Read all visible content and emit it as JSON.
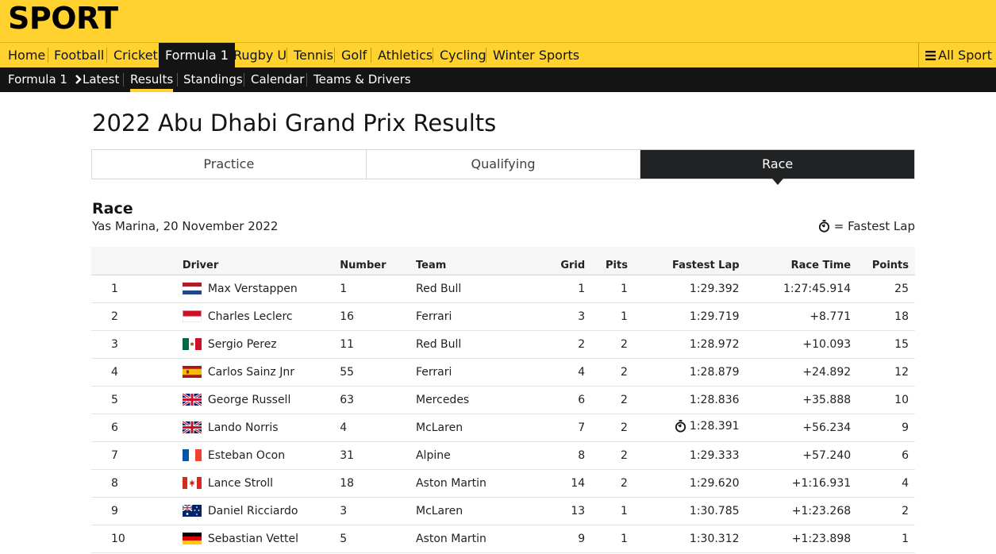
{
  "brand": {
    "logo": "SPORT",
    "accent": "#ffd230",
    "dark": "#202224"
  },
  "primary_nav": {
    "items": [
      "Home",
      "Football",
      "Cricket",
      "Formula 1",
      "Rugby U",
      "Tennis",
      "Golf",
      "Athletics",
      "Cycling",
      "Winter Sports"
    ],
    "active": "Formula 1",
    "all_sport_label": "All Sport"
  },
  "secondary_nav": {
    "section": "Formula 1",
    "items": [
      "Latest",
      "Results",
      "Standings",
      "Calendar",
      "Teams & Drivers"
    ],
    "current": "Results"
  },
  "page": {
    "title": "2022 Abu Dhabi Grand Prix Results"
  },
  "tabs": {
    "items": [
      "Practice",
      "Qualifying",
      "Race"
    ],
    "selected": "Race"
  },
  "section": {
    "title": "Race",
    "subtitle": "Yas Marina, 20 November 2022",
    "legend_label": "= Fastest Lap",
    "legend_icon": "stopwatch-icon"
  },
  "table": {
    "headers": {
      "driver": "Driver",
      "number": "Number",
      "team": "Team",
      "grid": "Grid",
      "pits": "Pits",
      "fastest_lap": "Fastest Lap",
      "race_time": "Race Time",
      "points": "Points"
    },
    "rows": [
      {
        "pos": "1",
        "flag": "NED",
        "driver": "Max Verstappen",
        "number": "1",
        "team": "Red Bull",
        "grid": "1",
        "pits": "1",
        "fastest_lap": "1:29.392",
        "fastest": false,
        "race_time": "1:27:45.914",
        "points": "25"
      },
      {
        "pos": "2",
        "flag": "MON",
        "driver": "Charles Leclerc",
        "number": "16",
        "team": "Ferrari",
        "grid": "3",
        "pits": "1",
        "fastest_lap": "1:29.719",
        "fastest": false,
        "race_time": "+8.771",
        "points": "18"
      },
      {
        "pos": "3",
        "flag": "MEX",
        "driver": "Sergio Perez",
        "number": "11",
        "team": "Red Bull",
        "grid": "2",
        "pits": "2",
        "fastest_lap": "1:28.972",
        "fastest": false,
        "race_time": "+10.093",
        "points": "15"
      },
      {
        "pos": "4",
        "flag": "ESP",
        "driver": "Carlos Sainz Jnr",
        "number": "55",
        "team": "Ferrari",
        "grid": "4",
        "pits": "2",
        "fastest_lap": "1:28.879",
        "fastest": false,
        "race_time": "+24.892",
        "points": "12"
      },
      {
        "pos": "5",
        "flag": "GBR",
        "driver": "George Russell",
        "number": "63",
        "team": "Mercedes",
        "grid": "6",
        "pits": "2",
        "fastest_lap": "1:28.836",
        "fastest": false,
        "race_time": "+35.888",
        "points": "10"
      },
      {
        "pos": "6",
        "flag": "GBR",
        "driver": "Lando Norris",
        "number": "4",
        "team": "McLaren",
        "grid": "7",
        "pits": "2",
        "fastest_lap": "1:28.391",
        "fastest": true,
        "race_time": "+56.234",
        "points": "9"
      },
      {
        "pos": "7",
        "flag": "FRA",
        "driver": "Esteban Ocon",
        "number": "31",
        "team": "Alpine",
        "grid": "8",
        "pits": "2",
        "fastest_lap": "1:29.333",
        "fastest": false,
        "race_time": "+57.240",
        "points": "6"
      },
      {
        "pos": "8",
        "flag": "CAN",
        "driver": "Lance Stroll",
        "number": "18",
        "team": "Aston Martin",
        "grid": "14",
        "pits": "2",
        "fastest_lap": "1:29.620",
        "fastest": false,
        "race_time": "+1:16.931",
        "points": "4"
      },
      {
        "pos": "9",
        "flag": "AUS",
        "driver": "Daniel Ricciardo",
        "number": "3",
        "team": "McLaren",
        "grid": "13",
        "pits": "1",
        "fastest_lap": "1:30.785",
        "fastest": false,
        "race_time": "+1:23.268",
        "points": "2"
      },
      {
        "pos": "10",
        "flag": "GER",
        "driver": "Sebastian Vettel",
        "number": "5",
        "team": "Aston Martin",
        "grid": "9",
        "pits": "1",
        "fastest_lap": "1:30.312",
        "fastest": false,
        "race_time": "+1:23.898",
        "points": "1"
      }
    ]
  }
}
